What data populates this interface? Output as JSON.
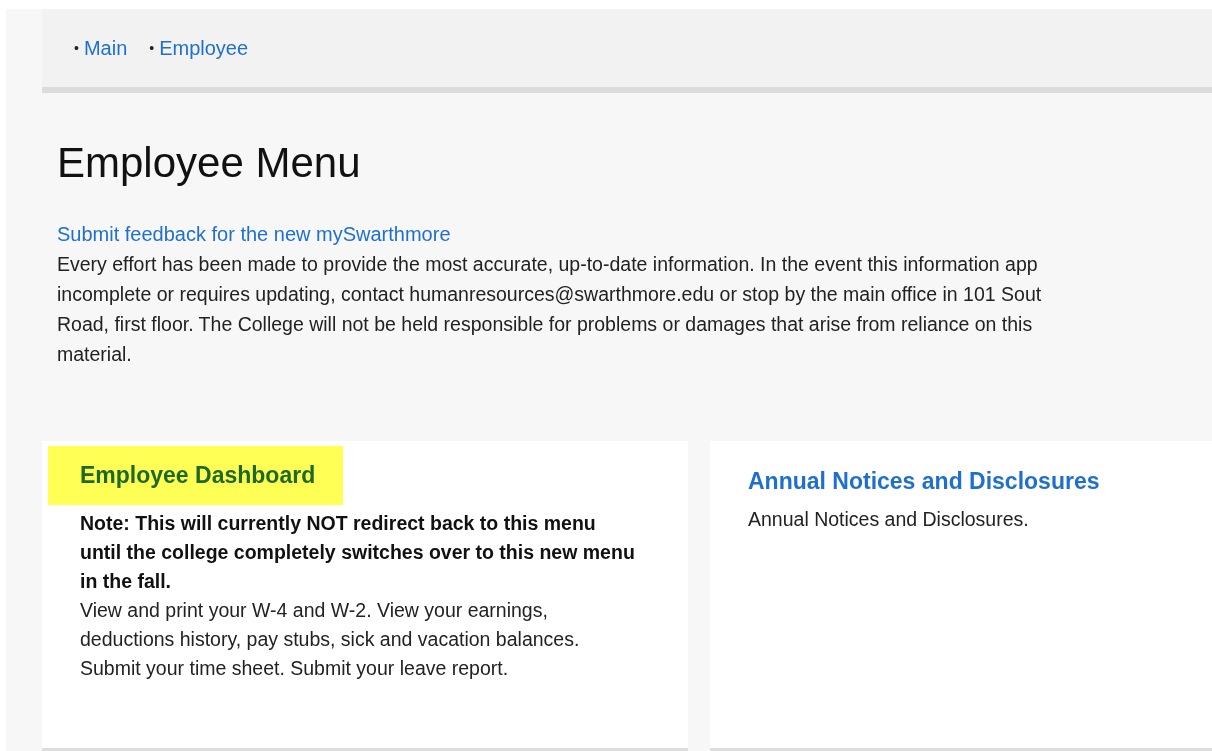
{
  "breadcrumb": [
    {
      "bullet": "•",
      "label": "Main"
    },
    {
      "bullet": "•",
      "label": "Employee"
    }
  ],
  "heading": "Employee Menu",
  "feedback_link": "Submit feedback for the new mySwarthmore",
  "disclaimer": [
    "Every effort has been made to provide the most accurate, up-to-date information. In the event this information app",
    "incomplete or requires updating, contact humanresources@swarthmore.edu or stop by the main office in 101 Sout",
    "Road, first floor. The College will not be held responsible for problems or damages that arise from reliance on this",
    "material."
  ],
  "cards": [
    {
      "title": "Employee Dashboard",
      "highlighted": true,
      "note": "Note: This will currently NOT redirect back to this menu until the college completely switches over to this new menu in the fall.",
      "text": "View and print your W-4 and W-2. View your earnings, deductions history, pay stubs, sick and vacation balances. Submit your time sheet. Submit your leave report."
    },
    {
      "title": "Annual Notices and Disclosures",
      "highlighted": false,
      "text": "Annual Notices and Disclosures."
    }
  ]
}
